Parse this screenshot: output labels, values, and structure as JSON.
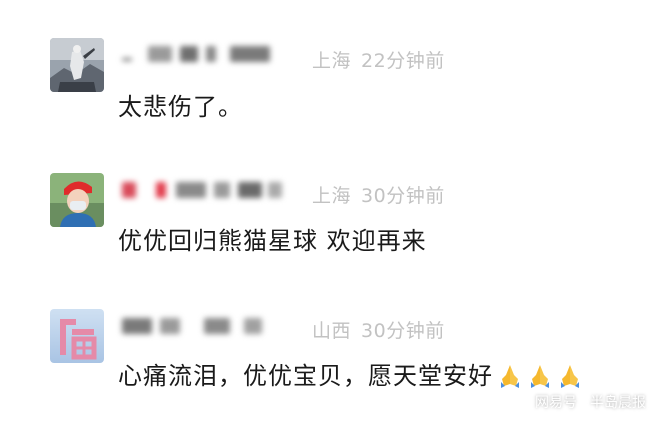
{
  "comments": [
    {
      "location": "上海",
      "time": "22分钟前",
      "text": "太悲伤了。",
      "avatar": "warrior-figure-avatar"
    },
    {
      "location": "上海",
      "time": "30分钟前",
      "text": "优优回归熊猫星球 欢迎再来",
      "avatar": "person-red-hat-avatar"
    },
    {
      "location": "山西",
      "time": "30分钟前",
      "text": "心痛流泪，优优宝贝，愿天堂安好",
      "emoji": [
        "folded-hands-icon",
        "folded-hands-icon",
        "folded-hands-icon"
      ],
      "avatar": "fu-character-avatar"
    }
  ],
  "watermark": {
    "left": "网易号",
    "right": "半岛晨报"
  },
  "colors": {
    "text": "#1a1a1a",
    "meta": "#c2c2c2",
    "background": "#ffffff"
  }
}
